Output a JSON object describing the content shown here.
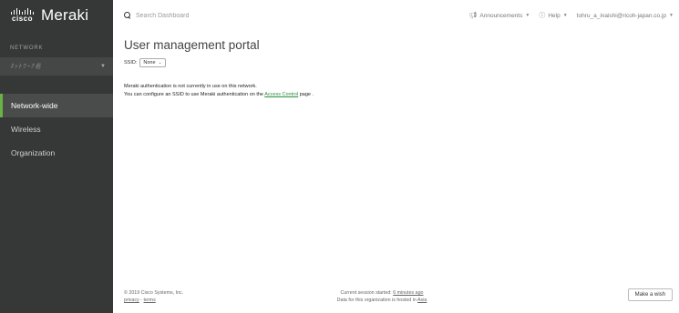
{
  "brand": {
    "logo_word": "cisco",
    "product": "Meraki"
  },
  "sidebar": {
    "network_label": "NETWORK",
    "network_name": "ﾈｯﾄﾜｰｸ名",
    "items": [
      {
        "label": "Network-wide",
        "active": true
      },
      {
        "label": "Wireless",
        "active": false
      },
      {
        "label": "Organization",
        "active": false
      }
    ]
  },
  "topbar": {
    "search_placeholder": "Search Dashboard",
    "announcements": "Announcements",
    "help": "Help",
    "user": "tohru_a_inaishi@ricoh-japan.co.jp"
  },
  "main": {
    "title": "User management portal",
    "ssid_label": "SSID:",
    "ssid_value": "None",
    "info_line1": "Meraki authentication is not currently in use on this network.",
    "info_line2_prefix": "You can configure an SSID to use Meraki authentication on the",
    "info_link": "Access Control",
    "info_line2_suffix": "page ."
  },
  "footer": {
    "copyright": "© 2019 Cisco Systems, Inc.",
    "privacy": "privacy",
    "separator": " - ",
    "terms": "terms",
    "session_prefix": "Current session started:",
    "session_time": "6 minutes ago",
    "hosted_prefix": "Data for this organization is hosted in",
    "hosted_region": "Asia",
    "wish_button": "Make a wish"
  },
  "colors": {
    "sidebar_bg": "#363737",
    "accent_green": "#67b346",
    "link_green": "#2a8c3a"
  }
}
